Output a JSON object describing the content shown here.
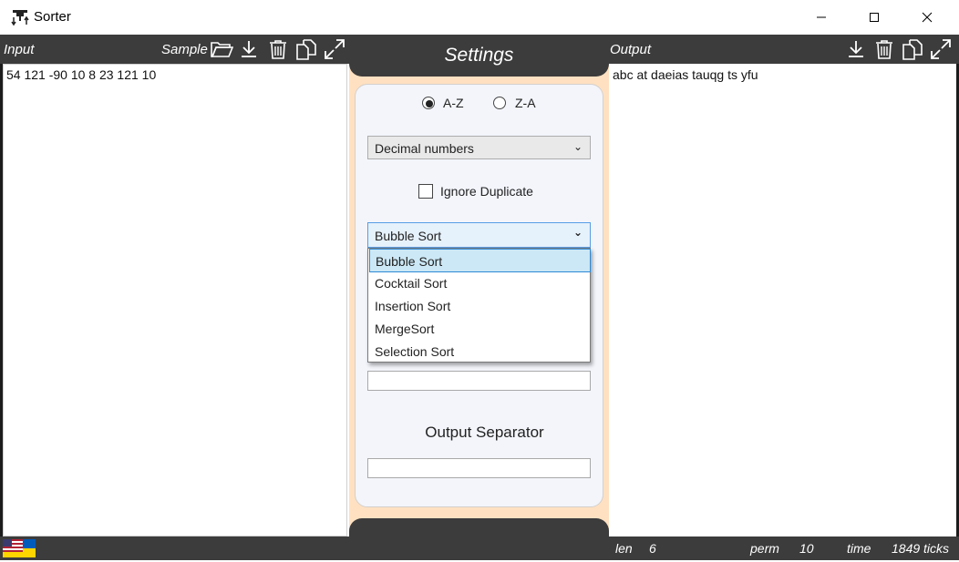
{
  "window": {
    "title": "Sorter",
    "controls": {
      "minimize": "minimize",
      "maximize": "maximize",
      "close": "close"
    }
  },
  "input_panel": {
    "label": "Input",
    "sample_label": "Sample",
    "icons": [
      "open-folder-icon",
      "download-icon",
      "trash-icon",
      "copy-icon",
      "expand-icon"
    ],
    "text": "54 121 -90 10 8 23 121 10"
  },
  "output_panel": {
    "label": "Output",
    "icons": [
      "download-icon",
      "trash-icon",
      "copy-icon",
      "expand-icon"
    ],
    "text": "abc at daeias tauqg ts yfu"
  },
  "settings": {
    "title": "Settings",
    "order": {
      "az_label": "A-Z",
      "za_label": "Z-A",
      "selected": "A-Z"
    },
    "type_combo": {
      "value": "Decimal numbers"
    },
    "ignore_duplicate": {
      "label": "Ignore Duplicate",
      "checked": false
    },
    "algorithm_combo": {
      "value": "Bubble Sort",
      "options": [
        "Bubble Sort",
        "Cocktail Sort",
        "Insertion Sort",
        "MergeSort",
        "Selection Sort"
      ],
      "highlighted_index": 0
    },
    "output_separator_label": "Output Separator"
  },
  "status": {
    "len_label": "len",
    "len_value": "6",
    "perm_label": "perm",
    "perm_value": "10",
    "time_label": "time",
    "time_value": "1849 ticks"
  },
  "colors": {
    "dark": "#3c3c3c",
    "settings_bg": "#ffe1c1",
    "panel_bg": "#f3f5fb",
    "highlight": "#cce8f6"
  }
}
